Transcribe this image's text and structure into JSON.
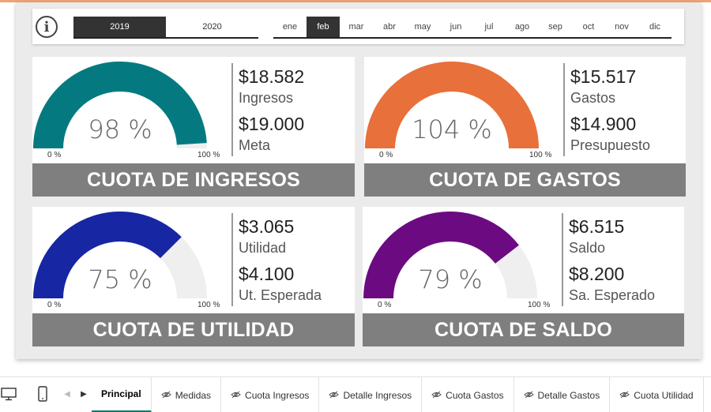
{
  "slicers": {
    "years": [
      {
        "label": "2019",
        "selected": true
      },
      {
        "label": "2020",
        "selected": false
      }
    ],
    "months": [
      {
        "label": "ene",
        "selected": false
      },
      {
        "label": "feb",
        "selected": true
      },
      {
        "label": "mar",
        "selected": false
      },
      {
        "label": "abr",
        "selected": false
      },
      {
        "label": "may",
        "selected": false
      },
      {
        "label": "jun",
        "selected": false
      },
      {
        "label": "jul",
        "selected": false
      },
      {
        "label": "ago",
        "selected": false
      },
      {
        "label": "sep",
        "selected": false
      },
      {
        "label": "oct",
        "selected": false
      },
      {
        "label": "nov",
        "selected": false
      },
      {
        "label": "dic",
        "selected": false
      }
    ]
  },
  "kpis": [
    {
      "title": "CUOTA DE INGRESOS",
      "percent_label": "98 %",
      "fill": 0.98,
      "color": "#047a80",
      "min_label": "0 %",
      "max_label": "100 %",
      "value1": "$18.582",
      "label1": "Ingresos",
      "value2": "$19.000",
      "label2": "Meta"
    },
    {
      "title": "CUOTA DE GASTOS",
      "percent_label": "104 %",
      "fill": 1.0,
      "color": "#e8703a",
      "min_label": "0 %",
      "max_label": "100 %",
      "value1": "$15.517",
      "label1": "Gastos",
      "value2": "$14.900",
      "label2": "Presupuesto"
    },
    {
      "title": "CUOTA DE UTILIDAD",
      "percent_label": "75 %",
      "fill": 0.75,
      "color": "#1726a3",
      "min_label": "0 %",
      "max_label": "100 %",
      "value1": "$3.065",
      "label1": "Utilidad",
      "value2": "$4.100",
      "label2": "Ut. Esperada"
    },
    {
      "title": "CUOTA DE SALDO",
      "percent_label": "79 %",
      "fill": 0.79,
      "color": "#6c0a82",
      "min_label": "0 %",
      "max_label": "100 %",
      "value1": "$6.515",
      "label1": "Saldo",
      "value2": "$8.200",
      "label2": "Sa. Esperado"
    }
  ],
  "gauge_track_color": "#efefef",
  "tabs": [
    {
      "label": "Principal",
      "active": true,
      "hidden_icon": false
    },
    {
      "label": "Medidas",
      "active": false,
      "hidden_icon": true
    },
    {
      "label": "Cuota Ingresos",
      "active": false,
      "hidden_icon": true
    },
    {
      "label": "Detalle Ingresos",
      "active": false,
      "hidden_icon": true
    },
    {
      "label": "Cuota Gastos",
      "active": false,
      "hidden_icon": true
    },
    {
      "label": "Detalle Gastos",
      "active": false,
      "hidden_icon": true
    },
    {
      "label": "Cuota Utilidad",
      "active": false,
      "hidden_icon": true
    }
  ],
  "icons": {
    "info": "info-icon",
    "desktop": "desktop-layout-icon",
    "phone": "phone-layout-icon",
    "prev": "chevron-left-icon",
    "next": "chevron-right-icon",
    "hidden": "hidden-page-icon"
  }
}
